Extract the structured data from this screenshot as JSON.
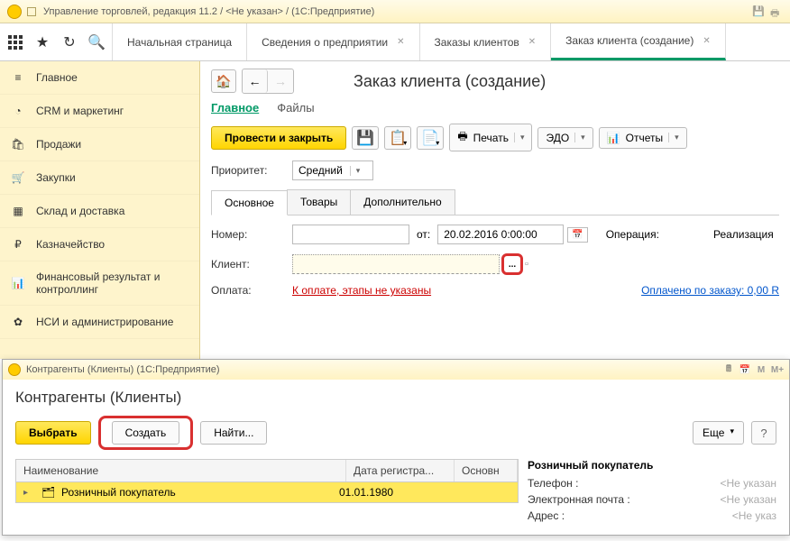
{
  "titlebar": {
    "text": "Управление торговлей, редакция 11.2 / <Не указан> / (1С:Предприятие)"
  },
  "tabs": [
    {
      "label": "Начальная страница",
      "closable": false
    },
    {
      "label": "Сведения о предприятии",
      "closable": true
    },
    {
      "label": "Заказы клиентов",
      "closable": true
    },
    {
      "label": "Заказ клиента (создание)",
      "closable": true,
      "active": true
    }
  ],
  "sidebar": {
    "items": [
      {
        "label": "Главное"
      },
      {
        "label": "CRM и маркетинг"
      },
      {
        "label": "Продажи"
      },
      {
        "label": "Закупки"
      },
      {
        "label": "Склад и доставка"
      },
      {
        "label": "Казначейство"
      },
      {
        "label": "Финансовый результат и контроллинг"
      },
      {
        "label": "НСИ и администрирование"
      }
    ]
  },
  "content": {
    "title": "Заказ клиента (создание)",
    "subtabs": {
      "main": "Главное",
      "files": "Файлы"
    },
    "actions": {
      "post_close": "Провести и закрыть",
      "print": "Печать",
      "edo": "ЭДО",
      "reports": "Отчеты"
    },
    "priority_label": "Приоритет:",
    "priority_value": "Средний",
    "form_tabs": {
      "main": "Основное",
      "goods": "Товары",
      "extra": "Дополнительно"
    },
    "fields": {
      "number_label": "Номер:",
      "from_label": "от:",
      "date_value": "20.02.2016 0:00:00",
      "operation_label": "Операция:",
      "operation_value": "Реализация",
      "client_label": "Клиент:",
      "payment_label": "Оплата:",
      "payment_link": "К оплате, этапы не указаны",
      "paid_link": "Оплачено по заказу: 0,00 R"
    }
  },
  "window2": {
    "titlebar": "Контрагенты (Клиенты) (1С:Предприятие)",
    "heading": "Контрагенты (Клиенты)",
    "toolbar": {
      "select": "Выбрать",
      "create": "Создать",
      "find": "Найти...",
      "more": "Еще"
    },
    "table": {
      "columns": {
        "name": "Наименование",
        "date": "Дата регистра...",
        "base": "Основн"
      },
      "row": {
        "name": "Розничный покупатель",
        "date": "01.01.1980"
      }
    },
    "details": {
      "title": "Розничный покупатель",
      "phone_label": "Телефон :",
      "phone_value": "<Не указан",
      "email_label": "Электронная почта :",
      "email_value": "<Не указан",
      "address_label": "Адрес :",
      "address_value": "<Не указ"
    }
  }
}
